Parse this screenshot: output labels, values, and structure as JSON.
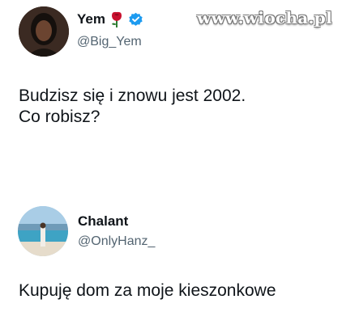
{
  "watermark": "www.wiocha.pl",
  "tweets": [
    {
      "display_name": "Yem",
      "name_icons": [
        "rose-icon",
        "verified-badge-icon"
      ],
      "handle": "@Big_Yem",
      "text": "Budzisz się i znowu jest 2002.\nCo robisz?"
    },
    {
      "display_name": "Chalant",
      "handle": "@OnlyHanz_",
      "text": "Kupuję dom za moje kieszonkowe"
    }
  ],
  "colors": {
    "text": "#0f1419",
    "handle": "#536471",
    "verified": "#1d9bf0",
    "rose": "#c8102e"
  }
}
